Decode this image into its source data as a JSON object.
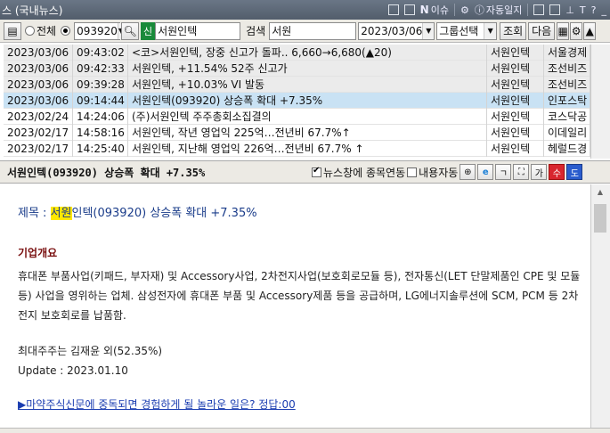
{
  "window": {
    "title": "스 (국내뉴스)"
  },
  "titlebar_tools": {
    "news": "이슈",
    "autolog": "자동일지",
    "font_t": "T",
    "help": "?"
  },
  "toolbar": {
    "radio_all": "전체",
    "stock_code": "093920",
    "badge_sin": "신",
    "stock_name": "서원인텍",
    "search_label": "검색",
    "search_value": "서원",
    "date": "2023/03/06",
    "group_select": "그룹선택",
    "query_button": "조회",
    "next_button": "다음"
  },
  "news_rows": [
    {
      "date": "2023/03/06",
      "time": "09:43:02",
      "title": "<코>서원인텍, 장중 신고가 돌파.. 6,660→6,680(▲20)",
      "stock": "서원인텍",
      "source": "서울경제"
    },
    {
      "date": "2023/03/06",
      "time": "09:42:33",
      "title": "서원인텍, +11.54% 52주 신고가",
      "stock": "서원인텍",
      "source": "조선비즈"
    },
    {
      "date": "2023/03/06",
      "time": "09:39:28",
      "title": "서원인텍, +10.03% VI 발동",
      "stock": "서원인텍",
      "source": "조선비즈"
    },
    {
      "date": "2023/03/06",
      "time": "09:14:44",
      "title": "서원인텍(093920) 상승폭 확대 +7.35%",
      "stock": "서원인텍",
      "source": "인포스탁"
    },
    {
      "date": "2023/02/24",
      "time": "14:24:06",
      "title": "(주)서원인텍 주주총회소집결의",
      "stock": "서원인텍",
      "source": "코스닥공"
    },
    {
      "date": "2023/02/17",
      "time": "14:58:16",
      "title": "서원인텍, 작년 영업익 225억…전년비 67.7%↑",
      "stock": "서원인텍",
      "source": "이데일리"
    },
    {
      "date": "2023/02/17",
      "time": "14:25:40",
      "title": "서원인텍, 지난해 영업익 226억…전년비 67.7% ↑",
      "stock": "서원인텍",
      "source": "헤럴드경"
    }
  ],
  "detail": {
    "header_title": "서원인텍(093920) 상승폭 확대 +7.35%",
    "link_news": "뉴스창에 종목연동",
    "auto_content": "내용자동",
    "btn_ga": "가",
    "btn_su": "수",
    "btn_do": "도"
  },
  "article": {
    "title_prefix": "제목 : ",
    "title_highlight": "서원",
    "title_rest": "인텍(093920) 상승폭 확대 +7.35%",
    "section_heading": "기업개요",
    "overview": "휴대폰 부품사업(키패드, 부자재) 및 Accessory사업, 2차전지사업(보호회로모듈 등), 전자통신(LET 단말제품인 CPE 및 모듈 등) 사업을 영위하는 업체. 삼성전자에 휴대폰 부품 및 Accessory제품 등을 공급하며, LG에너지솔루션에 SCM, PCM 등 2차전지 보호회로를 납품함.",
    "shareholder": "최대주주는 김재윤 외(52.35%)",
    "update": "Update : 2023.01.10",
    "promo_link": "▶마약주식신문에 중독되면 경험하게 될 놀라운 일은? 정답:00"
  },
  "colors": {
    "titlebar": "#5e6978",
    "selected_row": "#c9e2f4",
    "highlight": "#ffe800",
    "link": "#1a3cb0",
    "btn_su": "#d8262e",
    "btn_do": "#2a5ccd"
  }
}
